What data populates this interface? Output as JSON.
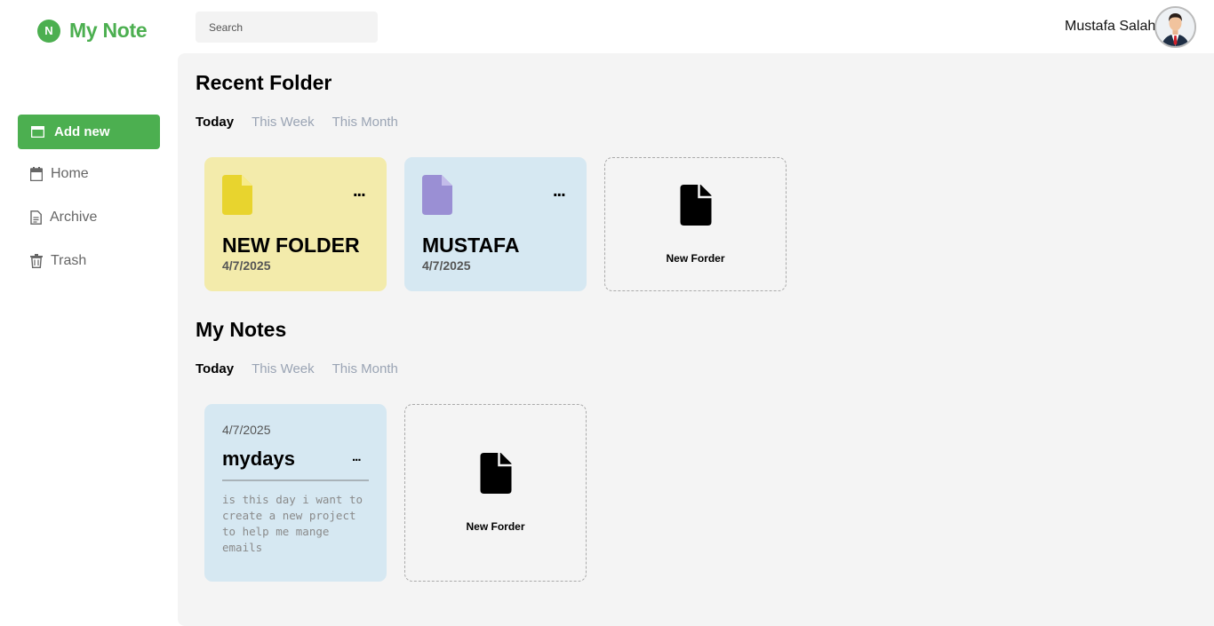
{
  "app": {
    "logo_letter": "N",
    "name": "My Note",
    "brand_color": "#4caf50"
  },
  "search": {
    "placeholder": "Search",
    "value": ""
  },
  "user": {
    "name": "Mustafa Salah"
  },
  "sidebar": {
    "add_new": {
      "label": "Add new",
      "icon": "window-icon"
    },
    "items": [
      {
        "label": "Home",
        "icon": "calendar-icon"
      },
      {
        "label": "Archive",
        "icon": "document-icon"
      },
      {
        "label": "Trash",
        "icon": "trash-icon"
      }
    ]
  },
  "recent_folder": {
    "title": "Recent Folder",
    "tabs": [
      "Today",
      "This Week",
      "This Month"
    ],
    "active_tab": "Today",
    "folders": [
      {
        "name": "NEW FOLDER",
        "date": "4/7/2025",
        "color": "#f3ebab",
        "icon_color": "#e8d42e"
      },
      {
        "name": "MUSTAFA",
        "date": "4/7/2025",
        "color": "#d6e8f2",
        "icon_color": "#9a8fd4"
      }
    ],
    "new_label": "New Forder"
  },
  "my_notes": {
    "title": "My Notes",
    "tabs": [
      "Today",
      "This Week",
      "This Month"
    ],
    "active_tab": "Today",
    "notes": [
      {
        "date": "4/7/2025",
        "title": "mydays",
        "body": "is this day i want to create a new project to help me mange emails"
      }
    ],
    "new_label": "New Forder"
  },
  "more_glyph": "..."
}
